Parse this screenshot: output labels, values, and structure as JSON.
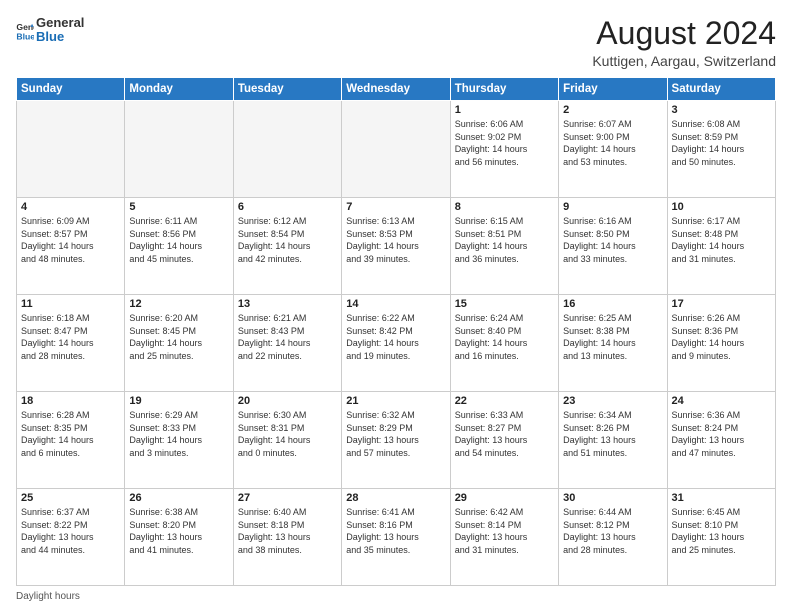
{
  "logo": {
    "line1": "General",
    "line2": "Blue"
  },
  "title": "August 2024",
  "subtitle": "Kuttigen, Aargau, Switzerland",
  "days_header": [
    "Sunday",
    "Monday",
    "Tuesday",
    "Wednesday",
    "Thursday",
    "Friday",
    "Saturday"
  ],
  "weeks": [
    [
      {
        "day": "",
        "info": ""
      },
      {
        "day": "",
        "info": ""
      },
      {
        "day": "",
        "info": ""
      },
      {
        "day": "",
        "info": ""
      },
      {
        "day": "1",
        "info": "Sunrise: 6:06 AM\nSunset: 9:02 PM\nDaylight: 14 hours\nand 56 minutes."
      },
      {
        "day": "2",
        "info": "Sunrise: 6:07 AM\nSunset: 9:00 PM\nDaylight: 14 hours\nand 53 minutes."
      },
      {
        "day": "3",
        "info": "Sunrise: 6:08 AM\nSunset: 8:59 PM\nDaylight: 14 hours\nand 50 minutes."
      }
    ],
    [
      {
        "day": "4",
        "info": "Sunrise: 6:09 AM\nSunset: 8:57 PM\nDaylight: 14 hours\nand 48 minutes."
      },
      {
        "day": "5",
        "info": "Sunrise: 6:11 AM\nSunset: 8:56 PM\nDaylight: 14 hours\nand 45 minutes."
      },
      {
        "day": "6",
        "info": "Sunrise: 6:12 AM\nSunset: 8:54 PM\nDaylight: 14 hours\nand 42 minutes."
      },
      {
        "day": "7",
        "info": "Sunrise: 6:13 AM\nSunset: 8:53 PM\nDaylight: 14 hours\nand 39 minutes."
      },
      {
        "day": "8",
        "info": "Sunrise: 6:15 AM\nSunset: 8:51 PM\nDaylight: 14 hours\nand 36 minutes."
      },
      {
        "day": "9",
        "info": "Sunrise: 6:16 AM\nSunset: 8:50 PM\nDaylight: 14 hours\nand 33 minutes."
      },
      {
        "day": "10",
        "info": "Sunrise: 6:17 AM\nSunset: 8:48 PM\nDaylight: 14 hours\nand 31 minutes."
      }
    ],
    [
      {
        "day": "11",
        "info": "Sunrise: 6:18 AM\nSunset: 8:47 PM\nDaylight: 14 hours\nand 28 minutes."
      },
      {
        "day": "12",
        "info": "Sunrise: 6:20 AM\nSunset: 8:45 PM\nDaylight: 14 hours\nand 25 minutes."
      },
      {
        "day": "13",
        "info": "Sunrise: 6:21 AM\nSunset: 8:43 PM\nDaylight: 14 hours\nand 22 minutes."
      },
      {
        "day": "14",
        "info": "Sunrise: 6:22 AM\nSunset: 8:42 PM\nDaylight: 14 hours\nand 19 minutes."
      },
      {
        "day": "15",
        "info": "Sunrise: 6:24 AM\nSunset: 8:40 PM\nDaylight: 14 hours\nand 16 minutes."
      },
      {
        "day": "16",
        "info": "Sunrise: 6:25 AM\nSunset: 8:38 PM\nDaylight: 14 hours\nand 13 minutes."
      },
      {
        "day": "17",
        "info": "Sunrise: 6:26 AM\nSunset: 8:36 PM\nDaylight: 14 hours\nand 9 minutes."
      }
    ],
    [
      {
        "day": "18",
        "info": "Sunrise: 6:28 AM\nSunset: 8:35 PM\nDaylight: 14 hours\nand 6 minutes."
      },
      {
        "day": "19",
        "info": "Sunrise: 6:29 AM\nSunset: 8:33 PM\nDaylight: 14 hours\nand 3 minutes."
      },
      {
        "day": "20",
        "info": "Sunrise: 6:30 AM\nSunset: 8:31 PM\nDaylight: 14 hours\nand 0 minutes."
      },
      {
        "day": "21",
        "info": "Sunrise: 6:32 AM\nSunset: 8:29 PM\nDaylight: 13 hours\nand 57 minutes."
      },
      {
        "day": "22",
        "info": "Sunrise: 6:33 AM\nSunset: 8:27 PM\nDaylight: 13 hours\nand 54 minutes."
      },
      {
        "day": "23",
        "info": "Sunrise: 6:34 AM\nSunset: 8:26 PM\nDaylight: 13 hours\nand 51 minutes."
      },
      {
        "day": "24",
        "info": "Sunrise: 6:36 AM\nSunset: 8:24 PM\nDaylight: 13 hours\nand 47 minutes."
      }
    ],
    [
      {
        "day": "25",
        "info": "Sunrise: 6:37 AM\nSunset: 8:22 PM\nDaylight: 13 hours\nand 44 minutes."
      },
      {
        "day": "26",
        "info": "Sunrise: 6:38 AM\nSunset: 8:20 PM\nDaylight: 13 hours\nand 41 minutes."
      },
      {
        "day": "27",
        "info": "Sunrise: 6:40 AM\nSunset: 8:18 PM\nDaylight: 13 hours\nand 38 minutes."
      },
      {
        "day": "28",
        "info": "Sunrise: 6:41 AM\nSunset: 8:16 PM\nDaylight: 13 hours\nand 35 minutes."
      },
      {
        "day": "29",
        "info": "Sunrise: 6:42 AM\nSunset: 8:14 PM\nDaylight: 13 hours\nand 31 minutes."
      },
      {
        "day": "30",
        "info": "Sunrise: 6:44 AM\nSunset: 8:12 PM\nDaylight: 13 hours\nand 28 minutes."
      },
      {
        "day": "31",
        "info": "Sunrise: 6:45 AM\nSunset: 8:10 PM\nDaylight: 13 hours\nand 25 minutes."
      }
    ]
  ],
  "footer": "Daylight hours"
}
